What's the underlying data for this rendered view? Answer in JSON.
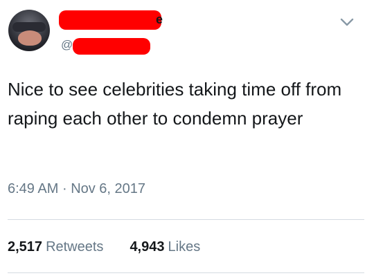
{
  "author": {
    "name_visible": "e",
    "handle_visible": "@"
  },
  "tweet": {
    "text": "Nice to see celebrities taking time off from raping each other to condemn prayer",
    "time": "6:49 AM",
    "separator": "·",
    "date": "Nov 6, 2017"
  },
  "stats": {
    "retweets_count": "2,517",
    "retweets_label": "Retweets",
    "likes_count": "4,943",
    "likes_label": "Likes"
  },
  "colors": {
    "redaction": "#ff0000",
    "secondary_text": "#657786",
    "primary_text": "#14171a"
  }
}
